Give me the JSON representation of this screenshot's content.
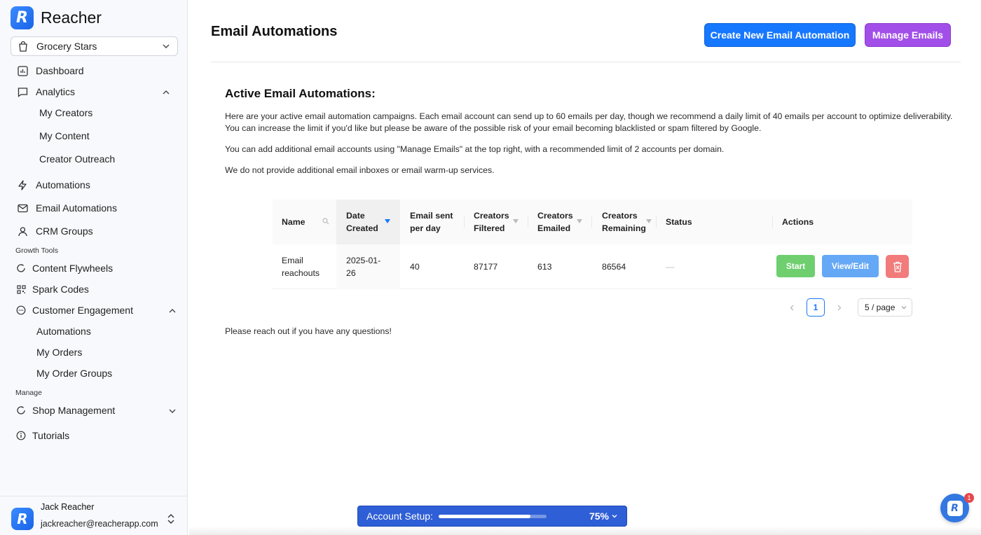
{
  "app": {
    "brand_name": "Reacher",
    "logo_letter": "R",
    "store": "Grocery Stars"
  },
  "sidebar": {
    "items": [
      {
        "label": "Dashboard"
      },
      {
        "label": "Analytics"
      },
      {
        "label": "My Creators"
      },
      {
        "label": "My Content"
      },
      {
        "label": "Creator Outreach"
      },
      {
        "label": "Automations"
      },
      {
        "label": "Email Automations"
      },
      {
        "label": "CRM Groups"
      }
    ],
    "growth_label": "Growth Tools",
    "growth_items": [
      {
        "label": "Content Flywheels"
      },
      {
        "label": "Spark Codes"
      },
      {
        "label": "Customer Engagement"
      },
      {
        "label": "Automations"
      },
      {
        "label": "My Orders"
      },
      {
        "label": "My Order Groups"
      }
    ],
    "manage_label": "Manage",
    "manage_items": [
      {
        "label": "Shop Management"
      },
      {
        "label": "Tutorials"
      }
    ]
  },
  "user": {
    "name": "Jack Reacher",
    "email": "jackreacher@reacherapp.com"
  },
  "header": {
    "title": "Email Automations",
    "create_button": "Create New Email Automation",
    "manage_button": "Manage Emails"
  },
  "content": {
    "section_title": "Active Email Automations:",
    "para1_line1": "Here are your active email automation campaigns. Each email account can send up to 60 emails per day, though we recommend a daily limit of 40 emails per account to optimize deliverability.",
    "para1_line2": "You can increase the limit if you'd like but please be aware of the possible risk of your email becoming blacklisted or spam filtered by Google.",
    "para2": "You can add additional email accounts using \"Manage Emails\" at the top right, with a recommended limit of 2 accounts per domain.",
    "para3": "We do not provide additional email inboxes or email warm-up services.",
    "footer_note": "Please reach out if you have any questions!"
  },
  "table": {
    "columns": [
      {
        "label_1": "Name",
        "label_2": ""
      },
      {
        "label_1": "Date",
        "label_2": "Created"
      },
      {
        "label_1": "Email sent",
        "label_2": "per day"
      },
      {
        "label_1": "Creators",
        "label_2": "Filtered"
      },
      {
        "label_1": "Creators",
        "label_2": "Emailed"
      },
      {
        "label_1": "Creators",
        "label_2": "Remaining"
      },
      {
        "label_1": "Status",
        "label_2": ""
      },
      {
        "label_1": "Actions",
        "label_2": ""
      }
    ],
    "rows": [
      {
        "name_1": "Email",
        "name_2": "reachouts",
        "date_1": "2025-01-",
        "date_2": "26",
        "sent_per_day": "40",
        "filtered": "87177",
        "emailed": "613",
        "remaining": "86564",
        "status": "—",
        "start_label": "Start",
        "view_label": "View/Edit"
      }
    ],
    "current_page": "1",
    "page_size": "5 / page"
  },
  "setup": {
    "label": "Account Setup:",
    "percent_text": "75%",
    "progress": 0.85
  },
  "chat": {
    "badge": "1"
  },
  "colors": {
    "primary": "#1677ff",
    "purple": "#a14fe8",
    "start_green": "#6fcf6f",
    "view_blue": "#65a8f5",
    "delete_red": "#f27b7b",
    "setup_blue": "#2f5fd6"
  }
}
